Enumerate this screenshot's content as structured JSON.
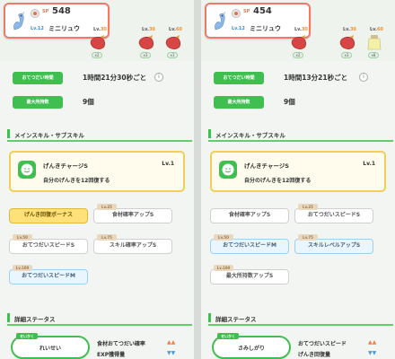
{
  "colors": {
    "green": "#3fbf4f",
    "gold": "#ffe17a",
    "blue": "#eaf6ff",
    "up": "#ef7a4a",
    "down": "#4a9adf"
  },
  "panels": [
    {
      "pokemon": {
        "sp_label": "SP",
        "sp_value": "548",
        "level": "Lv.12",
        "name": "ミニリュウ",
        "sprite_icon": "dratini-icon"
      },
      "evo_items": [
        {
          "lv": "Lv.",
          "lvt": "30",
          "qty": "x2"
        },
        {
          "lv": "Lv.",
          "lvt": "30",
          "qty": "x3"
        },
        {
          "lv": "Lv.",
          "lvt": "60",
          "qty": "x1"
        }
      ],
      "help_time_label": "おてつだい時間",
      "help_time_value": "1時間21分30秒ごと",
      "max_carry_label": "最大所持数",
      "max_carry_value": "9個",
      "skills_header": "メインスキル・サブスキル",
      "main_skill": {
        "name": "げんきチャージS",
        "level": "Lv.1",
        "desc": "自分のげんきを12回復する",
        "icon": "smile-icon"
      },
      "subskills": [
        {
          "tag": "",
          "label": "げんき回復ボーナス",
          "style": "gold"
        },
        {
          "tag": "Lv.25",
          "label": "食材確率アップS",
          "style": "white"
        },
        {
          "tag": "Lv.50",
          "label": "おてつだいスピードS",
          "style": "white"
        },
        {
          "tag": "Lv.75",
          "label": "スキル確率アップS",
          "style": "white"
        },
        {
          "tag": "Lv.100",
          "label": "おてつだいスピードM",
          "style": "blue"
        }
      ],
      "detail_header": "詳細ステータス",
      "nature": {
        "tag": "せいかく",
        "name": "れいせい"
      },
      "stats": [
        {
          "label": "食材おてつだい確率",
          "arrows": "▲▲",
          "dir": "up"
        },
        {
          "label": "EXP獲得量",
          "arrows": "▼▼",
          "dir": "down"
        }
      ]
    },
    {
      "pokemon": {
        "sp_label": "SP",
        "sp_value": "454",
        "level": "Lv.12",
        "name": "ミニリュウ",
        "sprite_icon": "dratini-icon"
      },
      "evo_items": [
        {
          "lv": "Lv.",
          "lvt": "30",
          "qty": "x2"
        },
        {
          "lv": "Lv.",
          "lvt": "30",
          "qty": "x3"
        },
        {
          "lv": "Lv.",
          "lvt": "60",
          "qty": "x8"
        }
      ],
      "help_time_label": "おてつだい時間",
      "help_time_value": "1時間13分21秒ごと",
      "max_carry_label": "最大所持数",
      "max_carry_value": "9個",
      "skills_header": "メインスキル・サブスキル",
      "main_skill": {
        "name": "げんきチャージS",
        "level": "Lv.1",
        "desc": "自分のげんきを12回復する",
        "icon": "smile-icon"
      },
      "subskills": [
        {
          "tag": "",
          "label": "食材確率アップS",
          "style": "white"
        },
        {
          "tag": "Lv.25",
          "label": "おてつだいスピードS",
          "style": "white"
        },
        {
          "tag": "Lv.50",
          "label": "おてつだいスピードM",
          "style": "blue"
        },
        {
          "tag": "Lv.75",
          "label": "スキルレベルアップS",
          "style": "blue"
        },
        {
          "tag": "Lv.100",
          "label": "最大所持数アップS",
          "style": "white"
        }
      ],
      "detail_header": "詳細ステータス",
      "nature": {
        "tag": "せいかく",
        "name": "さみしがり"
      },
      "stats": [
        {
          "label": "おてつだいスピード",
          "arrows": "▲▲",
          "dir": "up"
        },
        {
          "label": "げんき回復量",
          "arrows": "▼▼",
          "dir": "down"
        }
      ]
    }
  ]
}
